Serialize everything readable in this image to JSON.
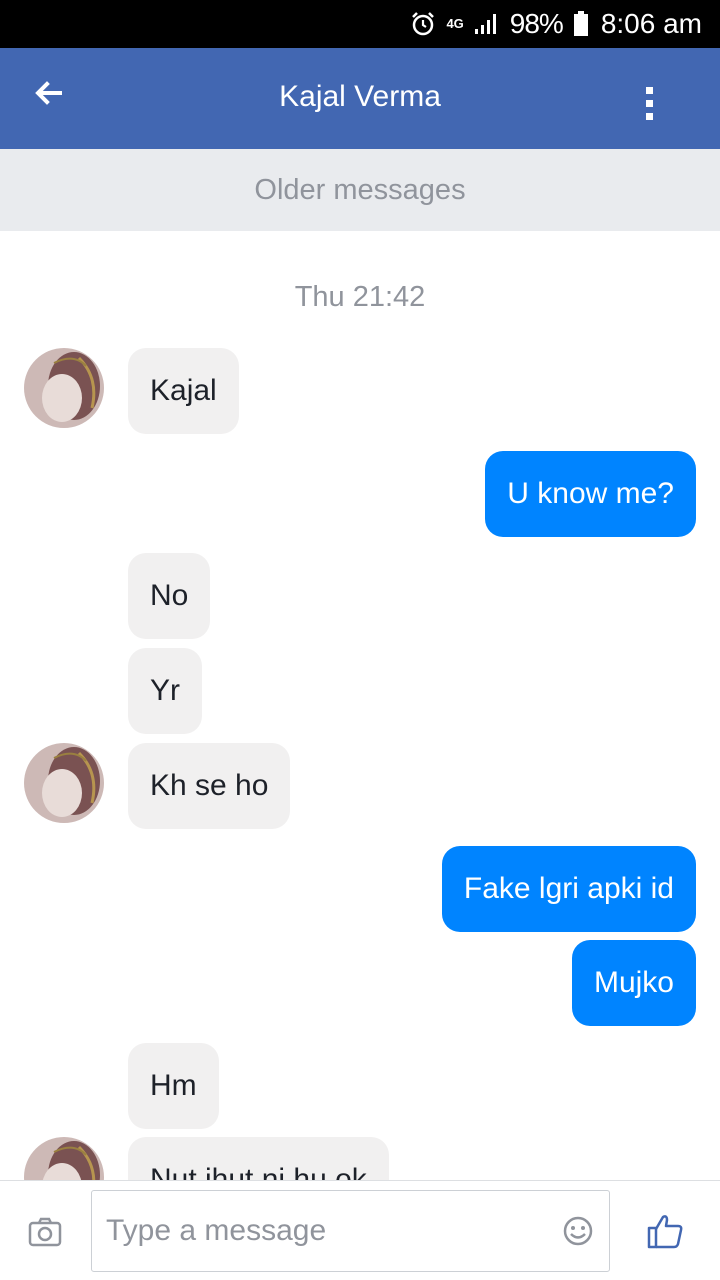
{
  "status_bar": {
    "network": "4G",
    "battery_percent": "98%",
    "time": "8:06 am"
  },
  "header": {
    "title": "Kajal Verma",
    "back_icon": "arrow-left-icon",
    "menu_icon": "more-vertical-icon"
  },
  "older_messages_label": "Older messages",
  "conversation": {
    "timestamp": "Thu 21:42",
    "messages": [
      {
        "from": "them",
        "text": "Kajal",
        "avatar": true
      },
      {
        "from": "me",
        "text": "U know me?"
      },
      {
        "from": "them",
        "text": "No"
      },
      {
        "from": "them",
        "text": "Yr"
      },
      {
        "from": "them",
        "text": "Kh se ho",
        "avatar": true
      },
      {
        "from": "me",
        "text": "Fake lgri apki id"
      },
      {
        "from": "me",
        "text": "Mujko"
      },
      {
        "from": "them",
        "text": "Hm"
      },
      {
        "from": "them",
        "text": "Nut ihut ni hu ok",
        "avatar": true
      }
    ]
  },
  "composer": {
    "placeholder": "Type a message",
    "camera_icon": "camera-icon",
    "emoji_icon": "emoji-icon",
    "like_icon": "thumbs-up-icon"
  },
  "colors": {
    "header": "#4267b2",
    "outgoing_bubble": "#0084ff",
    "incoming_bubble": "#f1f0f0"
  }
}
